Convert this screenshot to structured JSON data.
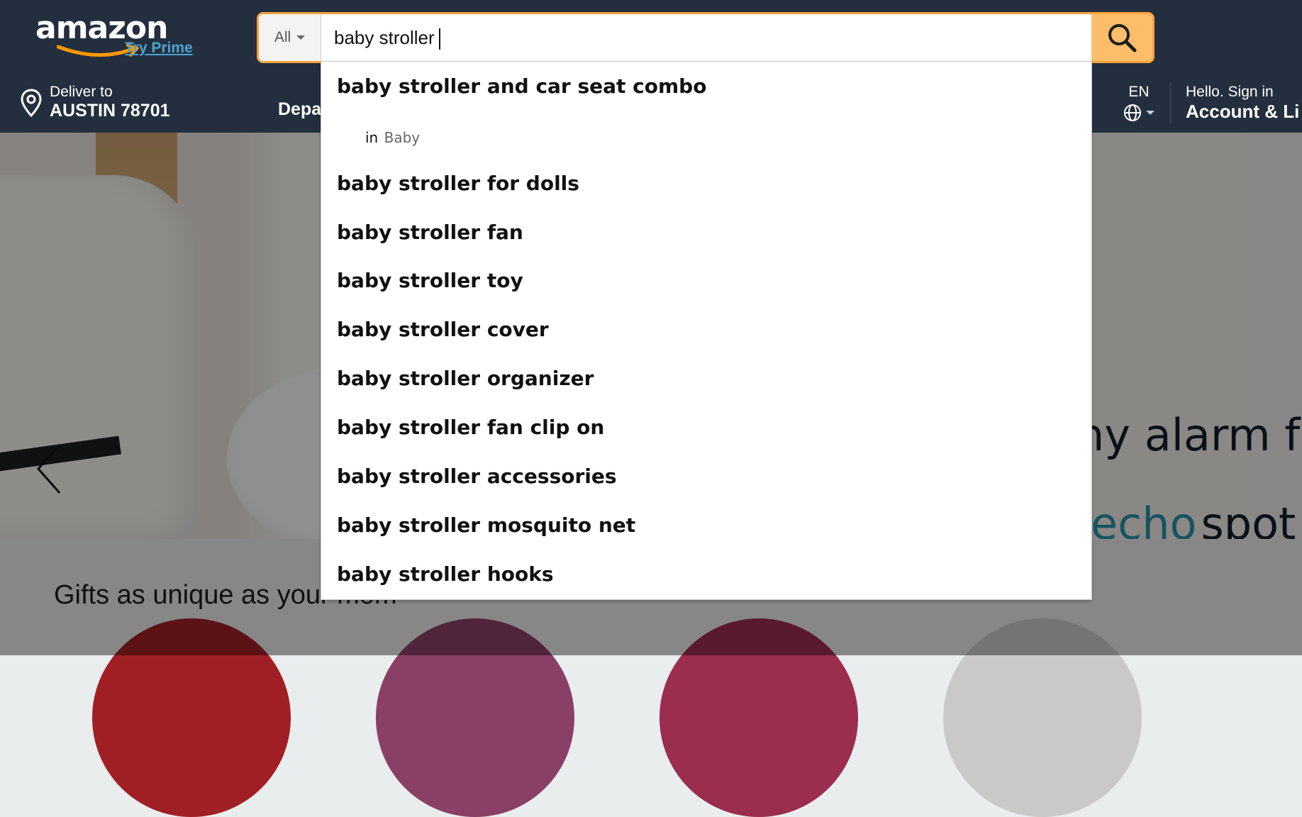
{
  "header": {
    "logo_text": "amazon",
    "try_prime": "Try Prime",
    "search": {
      "category": "All",
      "query": "baby stroller"
    },
    "deliver": {
      "line1": "Deliver to",
      "line2": "AUSTIN 78701"
    },
    "departments": "Depa",
    "language": "EN",
    "account": {
      "hello": "Hello. Sign in",
      "label": "Account & Li"
    }
  },
  "hero": {
    "text": "ny alarm for",
    "brand_part1": "echo",
    "brand_part2": "spot"
  },
  "gifts": {
    "title": "Gifts as unique as your mom"
  },
  "suggestions": {
    "items": [
      "baby stroller and car seat combo",
      "baby stroller for dolls",
      "baby stroller fan",
      "baby stroller toy",
      "baby stroller cover",
      "baby stroller organizer",
      "baby stroller fan clip on",
      "baby stroller accessories",
      "baby stroller mosquito net",
      "baby stroller hooks"
    ],
    "category_hint_prefix": "in",
    "category_hint": "Baby"
  },
  "colors": {
    "nav_bg": "#232f3e",
    "search_button": "#febd69",
    "focus_ring": "#f6a33d",
    "prime_link": "#4da3d3"
  },
  "icons": {
    "search": "search-icon",
    "location": "location-pin-icon",
    "globe": "globe-icon",
    "carousel_prev": "chevron-left-icon"
  }
}
